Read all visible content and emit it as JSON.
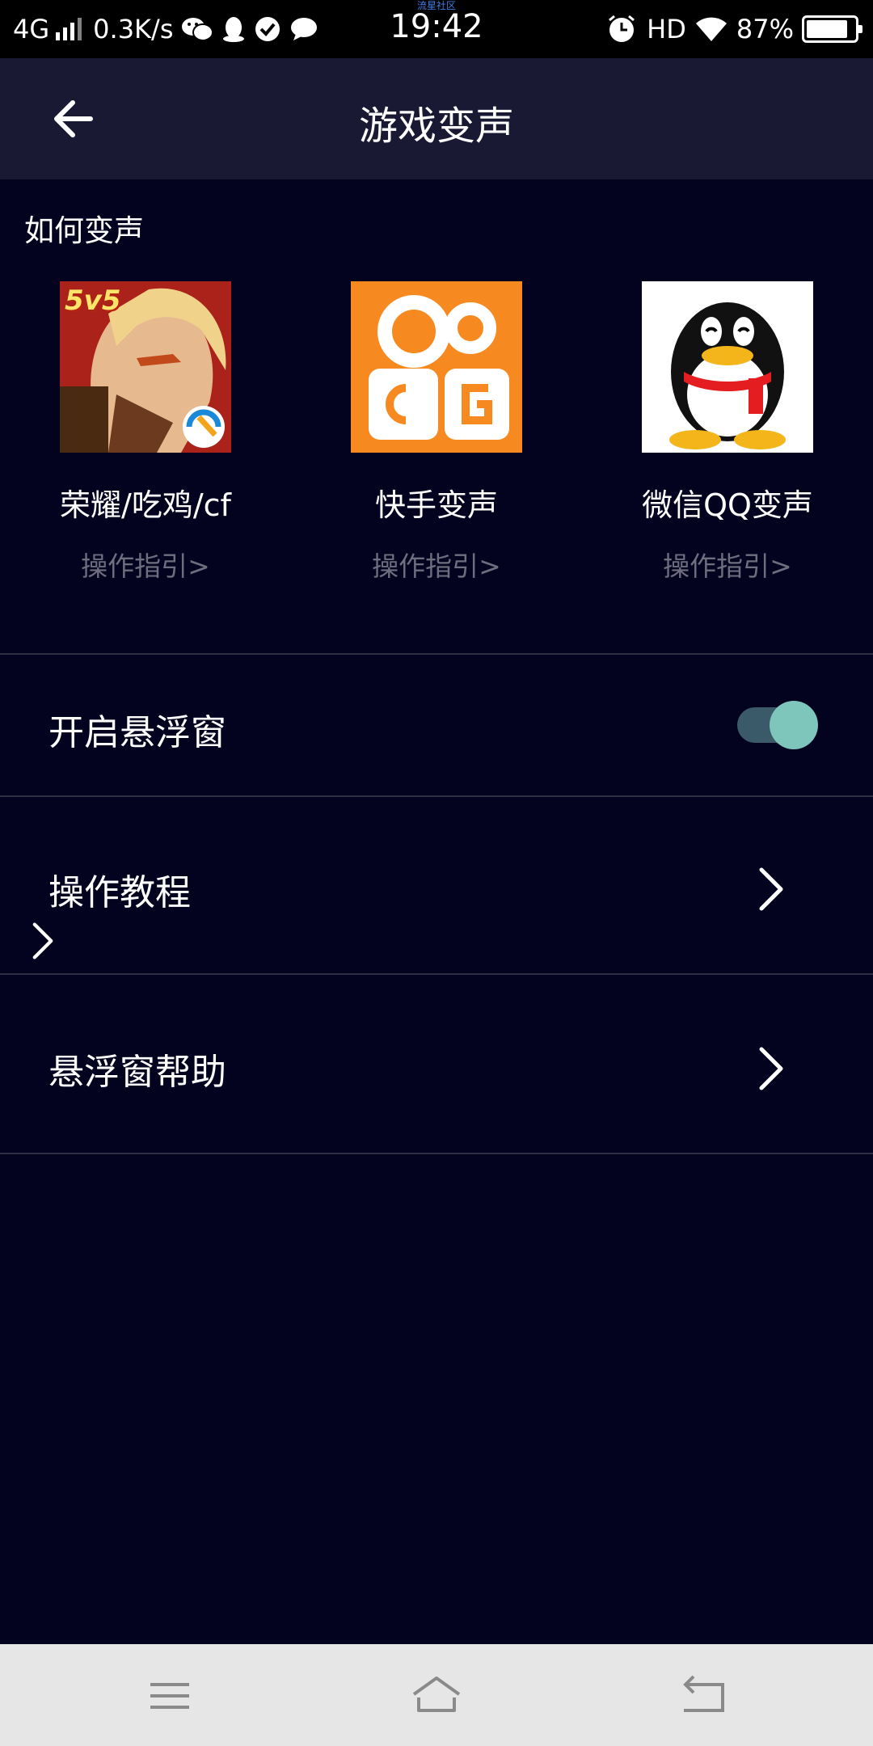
{
  "status_bar": {
    "network": "4G",
    "speed": "0.3K/s",
    "time": "19:42",
    "watermark": "流星社区",
    "hd": "HD",
    "battery": "87%",
    "battery_level": 0.87
  },
  "header": {
    "title": "游戏变声"
  },
  "how": {
    "label": "如何变声",
    "apps": [
      {
        "name": "荣耀/吃鸡/cf",
        "guide": "操作指引>",
        "badge": "5v5"
      },
      {
        "name": "快手变声",
        "guide": "操作指引>"
      },
      {
        "name": "微信QQ变声",
        "guide": "操作指引>"
      }
    ]
  },
  "settings": {
    "float_window": {
      "label": "开启悬浮窗",
      "enabled": true
    },
    "tutorial": {
      "label": "操作教程"
    },
    "help": {
      "label": "悬浮窗帮助"
    }
  },
  "colors": {
    "background": "#03021f",
    "header": "#1a1934",
    "toggle_on": "#7ec5bb",
    "guide_text": "#6f6e7e"
  }
}
